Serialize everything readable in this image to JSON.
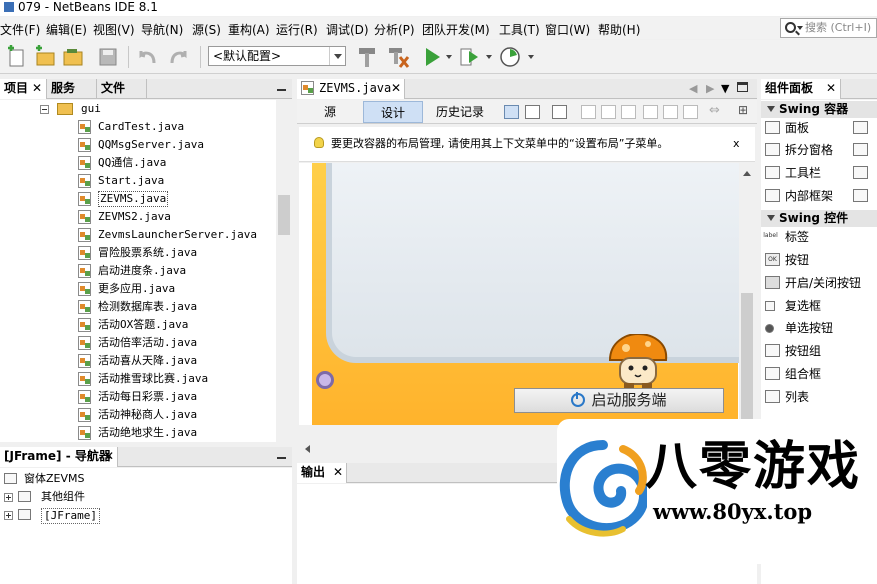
{
  "window": {
    "title": "079 - NetBeans IDE 8.1"
  },
  "menu": {
    "items": [
      "文件(F)",
      "编辑(E)",
      "视图(V)",
      "导航(N)",
      "源(S)",
      "重构(A)",
      "运行(R)",
      "调试(D)",
      "分析(P)",
      "团队开发(M)",
      "工具(T)",
      "窗口(W)",
      "帮助(H)"
    ],
    "search_placeholder": "搜索 (Ctrl+I)"
  },
  "toolbar": {
    "config_value": "<默认配置>"
  },
  "projects_panel": {
    "tabs": [
      "项目",
      "服务",
      "文件"
    ],
    "folder": "gui",
    "files": [
      "CardTest.java",
      "QQMsgServer.java",
      "QQ通信.java",
      "Start.java",
      "ZEVMS.java",
      "ZEVMS2.java",
      "ZevmsLauncherServer.java",
      "冒险股票系统.java",
      "启动进度条.java",
      "更多应用.java",
      "检测数据库表.java",
      "活动OX答题.java",
      "活动倍率活动.java",
      "活动喜从天降.java",
      "活动推雪球比赛.java",
      "活动每日彩票.java",
      "活动神秘商人.java",
      "活动绝地求生.java"
    ],
    "selected_file_index": 4
  },
  "navigator_panel": {
    "tab": "[JFrame] - 导航器",
    "root": "窗体ZEVMS",
    "children": [
      "其他组件",
      "[JFrame]"
    ]
  },
  "editor": {
    "tab": "ZEVMS.java",
    "subtabs": [
      "源",
      "设计",
      "历史记录"
    ],
    "active_subtab_index": 1,
    "hint_text": "要更改容器的布局管理, 请使用其上下文菜单中的“设置布局”子菜单。",
    "hint_close": "x",
    "start_button": "启动服务端"
  },
  "output_panel": {
    "tab": "输出"
  },
  "palette": {
    "tab": "组件面板",
    "categories": [
      {
        "name": "Swing 容器",
        "items": [
          "面板",
          "拆分窗格",
          "工具栏",
          "内部框架"
        ]
      },
      {
        "name": "Swing 控件",
        "items": [
          "标签",
          "按钮",
          "开启/关闭按钮",
          "复选框",
          "单选按钮",
          "按钮组",
          "组合框",
          "列表"
        ]
      }
    ],
    "label_icon_text": "label",
    "button_icon_text": "OK"
  },
  "watermark": {
    "name": "八零游戏",
    "url": "www.80yx.top"
  },
  "colors": {
    "accent": "#2a78c8",
    "selection": "#cfe0f5",
    "frame_orange": "#ffb32c"
  }
}
